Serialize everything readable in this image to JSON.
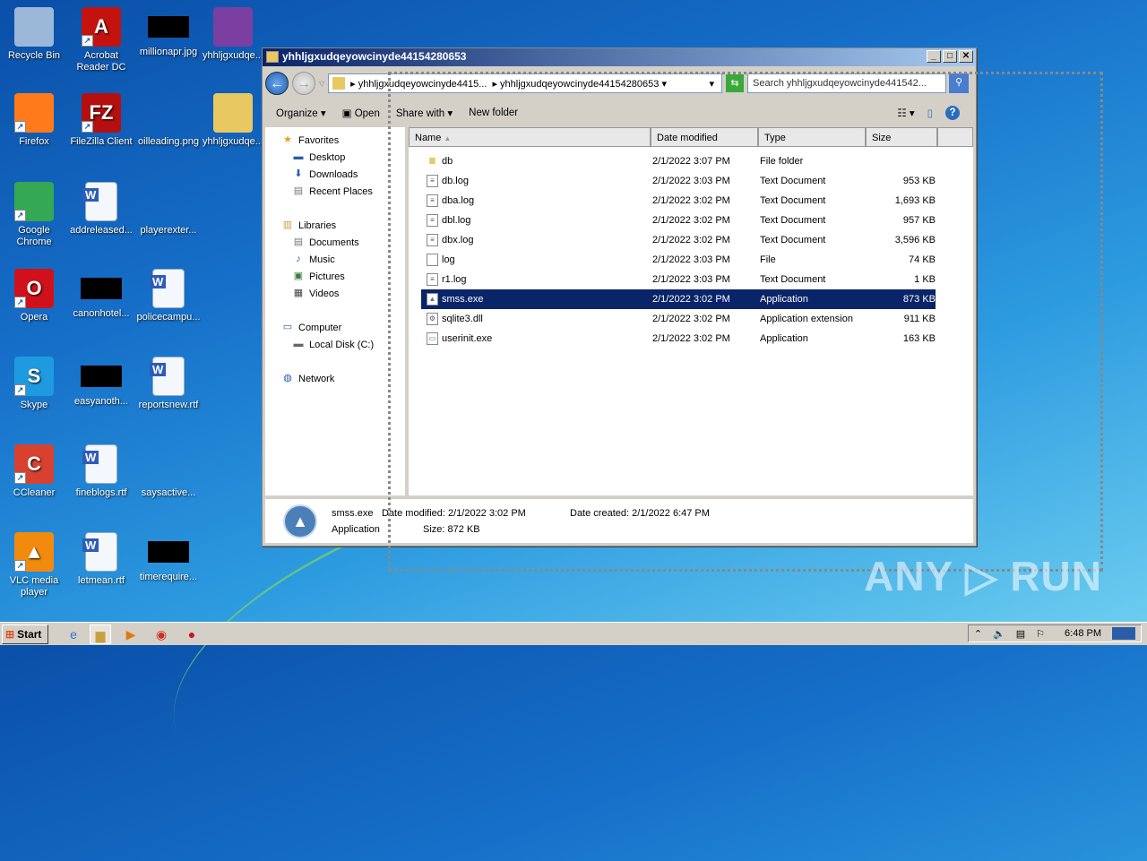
{
  "desktop": {
    "icons": [
      {
        "label": "Recycle Bin",
        "icon": "recycle-bin-icon",
        "color": "#9bb8d8"
      },
      {
        "label": "Acrobat Reader DC",
        "icon": "acrobat-icon",
        "color": "#c4120e",
        "glyph": "A"
      },
      {
        "label": "millionapr.jpg",
        "icon": "redacted-image",
        "black": true
      },
      {
        "label": "yhhljgxudqe...",
        "icon": "winrar-icon",
        "color": "#7a3fa0"
      },
      {
        "label": "Firefox",
        "icon": "firefox-icon",
        "color": "#ff7a1a"
      },
      {
        "label": "FileZilla Client",
        "icon": "filezilla-icon",
        "color": "#b50f0f",
        "glyph": "FZ"
      },
      {
        "label": "oilleading.png",
        "icon": "blank-file-icon"
      },
      {
        "label": "yhhljgxudqe...",
        "icon": "folder-icon",
        "color": "#e8c860"
      },
      {
        "label": "Google Chrome",
        "icon": "chrome-icon",
        "color": "#34a853"
      },
      {
        "label": "addreleased...",
        "icon": "word-doc-icon",
        "doc": true
      },
      {
        "label": "playerexter...",
        "icon": "blank-file-icon"
      },
      {
        "label": "Opera",
        "icon": "opera-icon",
        "color": "#d0101a",
        "glyph": "O"
      },
      {
        "label": "canonhotel...",
        "icon": "redacted-image",
        "black": true
      },
      {
        "label": "policecampu...",
        "icon": "word-doc-icon",
        "doc": true
      },
      {
        "label": "Skype",
        "icon": "skype-icon",
        "color": "#1e9be0",
        "glyph": "S"
      },
      {
        "label": "easyanoth...",
        "icon": "redacted-image",
        "black": true
      },
      {
        "label": "reportsnew.rtf",
        "icon": "word-doc-icon",
        "doc": true
      },
      {
        "label": "CCleaner",
        "icon": "ccleaner-icon",
        "color": "#d8412f",
        "glyph": "C"
      },
      {
        "label": "fineblogs.rtf",
        "icon": "word-doc-icon",
        "doc": true
      },
      {
        "label": "saysactive...",
        "icon": "blank-file-icon"
      },
      {
        "label": "VLC media player",
        "icon": "vlc-icon",
        "color": "#f28a0e",
        "glyph": "▲"
      },
      {
        "label": "letmean.rtf",
        "icon": "word-doc-icon",
        "doc": true
      },
      {
        "label": "timerequire...",
        "icon": "redacted-image",
        "black": true
      }
    ]
  },
  "window": {
    "title": "yhhljgxudqeyowcinyde44154280653",
    "breadcrumb": [
      "yhhljgxudqeyowcinyde4415...",
      "yhhljgxudqeyowcinyde44154280653"
    ],
    "search_placeholder": "Search yhhljgxudqeyowcinyde441542...",
    "toolbar": {
      "organize": "Organize ▾",
      "open": "Open",
      "share": "Share with ▾",
      "new_folder": "New folder"
    },
    "nav": [
      {
        "label": "Favorites",
        "icon": "star-icon",
        "g": "★",
        "c": "#e8a020",
        "indent": 0
      },
      {
        "label": "Desktop",
        "icon": "desktop-icon",
        "g": "▬",
        "c": "#2a5ca8",
        "indent": 1
      },
      {
        "label": "Downloads",
        "icon": "downloads-icon",
        "g": "⬇",
        "c": "#2a5ca8",
        "indent": 1
      },
      {
        "label": "Recent Places",
        "icon": "recent-places-icon",
        "g": "▤",
        "c": "#777",
        "indent": 1
      },
      {
        "label": "Libraries",
        "icon": "libraries-icon",
        "g": "▥",
        "c": "#c9a040",
        "indent": 0,
        "gap": true
      },
      {
        "label": "Documents",
        "icon": "documents-icon",
        "g": "▤",
        "c": "#777",
        "indent": 1
      },
      {
        "label": "Music",
        "icon": "music-icon",
        "g": "♪",
        "c": "#2a5ca8",
        "indent": 1
      },
      {
        "label": "Pictures",
        "icon": "pictures-icon",
        "g": "▣",
        "c": "#3a7a3a",
        "indent": 1
      },
      {
        "label": "Videos",
        "icon": "videos-icon",
        "g": "▦",
        "c": "#444",
        "indent": 1
      },
      {
        "label": "Computer",
        "icon": "computer-icon",
        "g": "▭",
        "c": "#2a5ca8",
        "indent": 0,
        "gap": true
      },
      {
        "label": "Local Disk (C:)",
        "icon": "disk-icon",
        "g": "▬",
        "c": "#666",
        "indent": 1
      },
      {
        "label": "Network",
        "icon": "network-icon",
        "g": "◍",
        "c": "#2a5ca8",
        "indent": 0,
        "gap": true
      }
    ],
    "columns": [
      "Name",
      "Date modified",
      "Type",
      "Size"
    ],
    "files": [
      {
        "name": "db",
        "date": "2/1/2022 3:07 PM",
        "type": "File folder",
        "size": "",
        "icon": "folder-icon"
      },
      {
        "name": "db.log",
        "date": "2/1/2022 3:03 PM",
        "type": "Text Document",
        "size": "953 KB",
        "icon": "text-file-icon"
      },
      {
        "name": "dba.log",
        "date": "2/1/2022 3:02 PM",
        "type": "Text Document",
        "size": "1,693 KB",
        "icon": "text-file-icon"
      },
      {
        "name": "dbl.log",
        "date": "2/1/2022 3:02 PM",
        "type": "Text Document",
        "size": "957 KB",
        "icon": "text-file-icon"
      },
      {
        "name": "dbx.log",
        "date": "2/1/2022 3:02 PM",
        "type": "Text Document",
        "size": "3,596 KB",
        "icon": "text-file-icon"
      },
      {
        "name": "log",
        "date": "2/1/2022 3:03 PM",
        "type": "File",
        "size": "74 KB",
        "icon": "file-icon"
      },
      {
        "name": "r1.log",
        "date": "2/1/2022 3:03 PM",
        "type": "Text Document",
        "size": "1 KB",
        "icon": "text-file-icon"
      },
      {
        "name": "smss.exe",
        "date": "2/1/2022 3:02 PM",
        "type": "Application",
        "size": "873 KB",
        "icon": "app-icon",
        "selected": true
      },
      {
        "name": "sqlite3.dll",
        "date": "2/1/2022 3:02 PM",
        "type": "Application extension",
        "size": "911 KB",
        "icon": "dll-icon"
      },
      {
        "name": "userinit.exe",
        "date": "2/1/2022 3:02 PM",
        "type": "Application",
        "size": "163 KB",
        "icon": "exe-icon"
      }
    ],
    "details": {
      "name": "smss.exe",
      "type": "Application",
      "modified": "Date modified: 2/1/2022 3:02 PM",
      "created": "Date created: 2/1/2022 6:47 PM",
      "size": "Size: 872 KB"
    }
  },
  "taskbar": {
    "start": "Start",
    "clock": "6:48 PM"
  },
  "watermark": "ANY ▷ RUN"
}
